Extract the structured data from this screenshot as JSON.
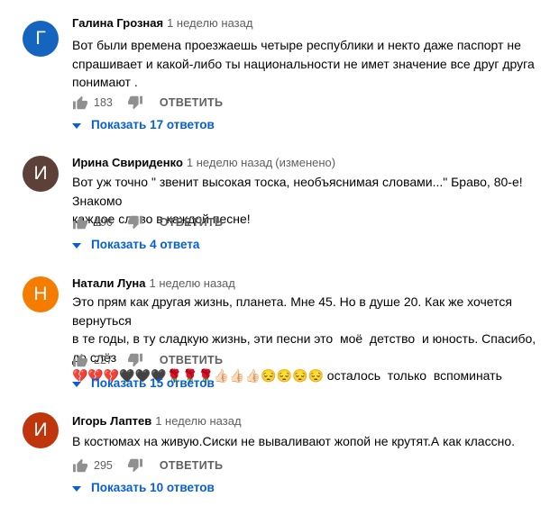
{
  "reply_label": "ОТВЕТИТЬ",
  "comments": [
    {
      "author": "Галина Грозная",
      "time": "1 неделю назад",
      "edited": "",
      "avatar_letter": "Г",
      "avatar_color": "#1565c0",
      "text": "Вот были времена проезжаешь четыре республики и некто даже паспорт не\nспрашивает и какой-либо ты национальности не имет значение все друг друга\nпонимают .",
      "likes": "183",
      "replies": "Показать 17 ответов"
    },
    {
      "author": "Ирина Свириденко",
      "time": "1 неделю назад",
      "edited": "(изменено)",
      "avatar_letter": "И",
      "avatar_color": "#5d4037",
      "text": "Вот уж точно \" звенит высокая тоска, необъяснимая словами...\" Браво, 80-е! Знакомо\nкаждое слово в каждой песне!",
      "likes": "196",
      "replies": "Показать 4 ответа"
    },
    {
      "author": "Натали Луна",
      "time": "1 неделю назад",
      "edited": "",
      "avatar_letter": "Н",
      "avatar_color": "#f57c00",
      "text": "Это прям как другая жизнь, планета. Мне 45. Но в душе 20. Как же хочется  вернуться\nв те годы, в ту сладкую жизнь, эти песни это  моё  детство  и юность. Спасибо,   до слёз\n💔💔💔🖤🖤🖤🌹🌹🌹👍🏻👍🏻👍🏻😔😔😔😔 осталось  только  вспоминать",
      "likes": "227",
      "replies": "Показать 15 ответов"
    },
    {
      "author": "Игорь Лаптев",
      "time": "1 неделю назад",
      "edited": "",
      "avatar_letter": "И",
      "avatar_color": "#bf360c",
      "text": "В костюмах на живую.Сиски не вываливают жопой не крутят.А как классно.",
      "likes": "295",
      "replies": "Показать 10 ответов"
    }
  ]
}
